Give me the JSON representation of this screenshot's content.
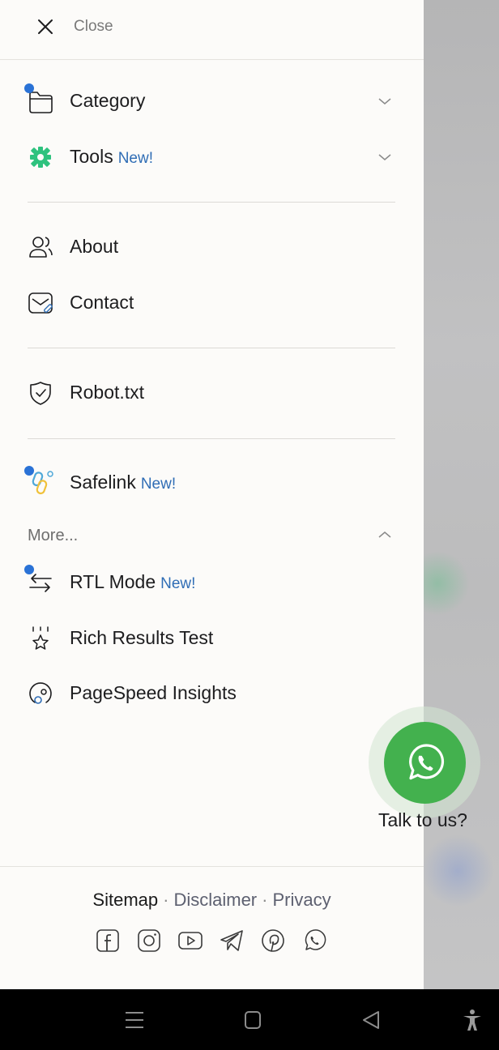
{
  "close_label": "Close",
  "menu": [
    {
      "label": "Category",
      "badge": "",
      "icon": "folder-icon",
      "has_dot": true,
      "expandable": true
    },
    {
      "label": "Tools",
      "badge": "New!",
      "icon": "gear-icon",
      "has_dot": false,
      "expandable": true
    },
    {
      "label": "About",
      "badge": "",
      "icon": "users-icon",
      "has_dot": false,
      "expandable": false
    },
    {
      "label": "Contact",
      "badge": "",
      "icon": "mail-edit-icon",
      "has_dot": false,
      "expandable": false
    },
    {
      "label": "Robot.txt",
      "badge": "",
      "icon": "shield-check-icon",
      "has_dot": false,
      "expandable": false
    },
    {
      "label": "Safelink",
      "badge": "New!",
      "icon": "link-icon",
      "has_dot": true,
      "expandable": false
    }
  ],
  "more_label": "More...",
  "more_items": [
    {
      "label": "RTL Mode",
      "badge": "New!",
      "icon": "arrows-swap-icon",
      "has_dot": true
    },
    {
      "label": "Rich Results Test",
      "badge": "",
      "icon": "star-sparkle-icon",
      "has_dot": false
    },
    {
      "label": "PageSpeed Insights",
      "badge": "",
      "icon": "gauge-icon",
      "has_dot": false
    }
  ],
  "footer": {
    "links": [
      "Sitemap",
      "Disclaimer",
      "Privacy"
    ],
    "separator": "·",
    "socials": [
      "facebook-icon",
      "instagram-icon",
      "youtube-icon",
      "telegram-icon",
      "pinterest-icon",
      "whatsapp-icon"
    ]
  },
  "whatsapp": {
    "label": "Talk to us?"
  },
  "colors": {
    "accent_blue": "#2f6db5",
    "dot_blue": "#2a72d6",
    "whatsapp_green": "#43b14e",
    "drawer_bg": "#fcfbf9"
  },
  "system_nav": [
    "recents-icon",
    "home-icon",
    "back-icon",
    "accessibility-icon"
  ]
}
